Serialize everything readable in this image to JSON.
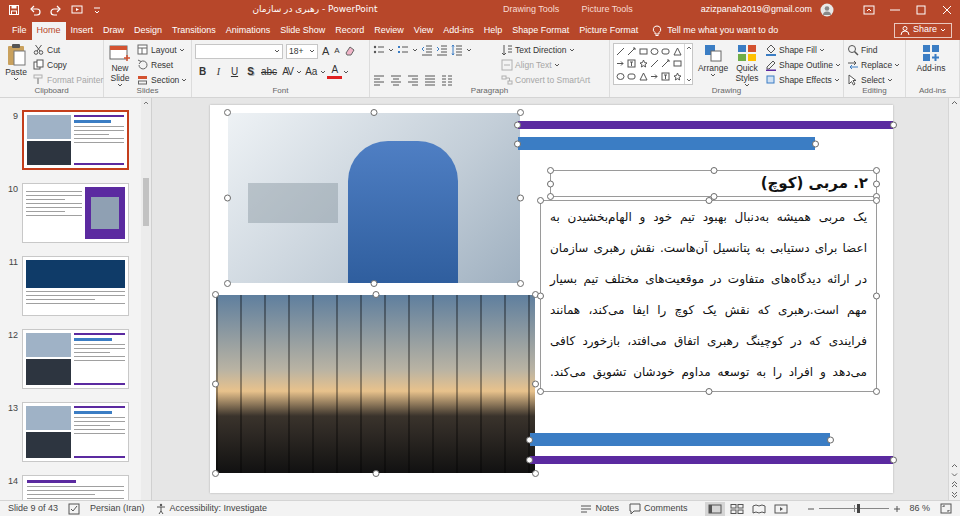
{
  "window": {
    "title": "رهبری در سازمان - PowerPoint",
    "contextual_tabs": [
      "Drawing Tools",
      "Picture Tools"
    ],
    "account": "azizpanah2019@gmail.com"
  },
  "tabs": [
    {
      "label": "File",
      "selected": false
    },
    {
      "label": "Home",
      "selected": true
    },
    {
      "label": "Insert",
      "selected": false
    },
    {
      "label": "Draw",
      "selected": false
    },
    {
      "label": "Design",
      "selected": false
    },
    {
      "label": "Transitions",
      "selected": false
    },
    {
      "label": "Animations",
      "selected": false
    },
    {
      "label": "Slide Show",
      "selected": false
    },
    {
      "label": "Record",
      "selected": false
    },
    {
      "label": "Review",
      "selected": false
    },
    {
      "label": "View",
      "selected": false
    },
    {
      "label": "Add-ins",
      "selected": false
    },
    {
      "label": "Help",
      "selected": false
    },
    {
      "label": "Shape Format",
      "selected": false
    },
    {
      "label": "Picture Format",
      "selected": false
    }
  ],
  "tell_me": "Tell me what you want to do",
  "share": "Share",
  "ribbon": {
    "clipboard": {
      "label": "Clipboard",
      "paste": "Paste",
      "items": [
        {
          "label": "Cut",
          "disabled": false
        },
        {
          "label": "Copy",
          "disabled": false
        },
        {
          "label": "Format Painter",
          "disabled": true
        }
      ]
    },
    "slides": {
      "label": "Slides",
      "new_slide": [
        "New",
        "Slide"
      ],
      "items": [
        "Layout",
        "Reset",
        "Section"
      ]
    },
    "font": {
      "label": "Font",
      "size": "18+",
      "grow": [
        "A",
        "A"
      ],
      "buttons": [
        {
          "text": "B",
          "kind": "bold"
        },
        {
          "text": "I",
          "kind": "italic"
        },
        {
          "text": "U",
          "kind": "underline"
        },
        {
          "text": "S",
          "kind": "shadow"
        },
        {
          "text": "abc",
          "kind": "strike"
        },
        {
          "text": "AV",
          "kind": "spacing"
        },
        {
          "text": "Aa",
          "kind": "case"
        },
        {
          "text": "A",
          "kind": "color"
        }
      ]
    },
    "paragraph": {
      "label": "Paragraph",
      "items": [
        {
          "label": "Text Direction",
          "disabled": false
        },
        {
          "label": "Align Text",
          "disabled": true
        },
        {
          "label": "Convert to SmartArt",
          "disabled": true
        }
      ]
    },
    "drawing": {
      "label": "Drawing",
      "arrange": "Arrange",
      "quick_styles": [
        "Quick",
        "Styles"
      ],
      "items": [
        "Shape Fill",
        "Shape Outline",
        "Shape Effects"
      ]
    },
    "editing": {
      "label": "Editing",
      "items": [
        "Find",
        "Replace",
        "Select"
      ]
    },
    "addins": {
      "label": "Add-ins",
      "button": "Add-ins"
    }
  },
  "slides": [
    {
      "number": "9",
      "selected": true,
      "kind": "image-left"
    },
    {
      "number": "10",
      "selected": false,
      "kind": "image-right"
    },
    {
      "number": "11",
      "selected": false,
      "kind": "image-top"
    },
    {
      "number": "12",
      "selected": false,
      "kind": "image-left"
    },
    {
      "number": "13",
      "selected": false,
      "kind": "image-left"
    },
    {
      "number": "14",
      "selected": false,
      "kind": "text"
    }
  ],
  "slide": {
    "heading": "۲. مربی (کوچ)",
    "lines": [
      "یک مربی همیشه به‌دنبال بهبود تیم خود و الهام‌بخشیدن به",
      "اعضا برای دستیابی به پتانسیل آن‌هاست. نقش رهبری سازمان",
      "در ارائه دیدگاه‌های متفاوت در موقعیت‌های مختلف تیم بسیار",
      "مهم است.رهبری که نقش یک کوچ را ایفا می‌کند، همانند",
      "فرایندی که در کوچینگ رهبری اتفاق می‌افتد، بازخورد کافی",
      "می‌دهد و افراد را به توسعه مداوم خودشان تشویق می‌کند."
    ]
  },
  "status": {
    "slide_info": "Slide 9 of 43",
    "language": "Persian (Iran)",
    "accessibility": "Accessibility: Investigate",
    "notes": "Notes",
    "comments": "Comments",
    "views": [
      {
        "kind": "normal",
        "selected": true
      },
      {
        "kind": "sorter",
        "selected": false
      },
      {
        "kind": "reading",
        "selected": false
      },
      {
        "kind": "slideshow",
        "selected": false
      }
    ],
    "zoom": "86 %",
    "zoom_level": 0.55
  }
}
